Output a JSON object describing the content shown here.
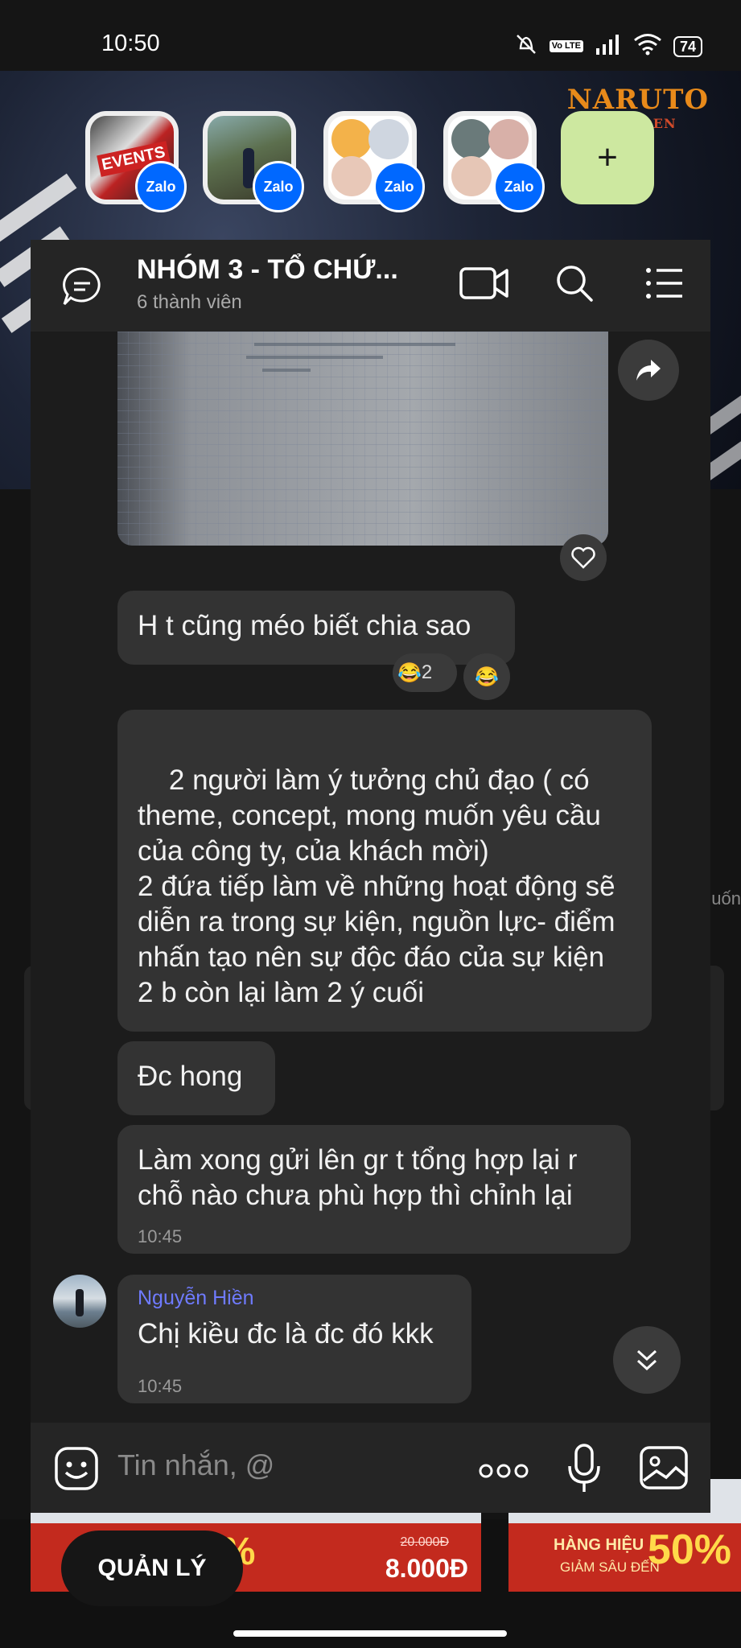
{
  "status_bar": {
    "time": "10:50",
    "network": "Vo LTE",
    "battery": "74"
  },
  "bubble_heads": [
    {
      "name": "events-group",
      "badge": "Zalo"
    },
    {
      "name": "photo-chat",
      "badge": "Zalo"
    },
    {
      "name": "group-chat-1",
      "badge": "Zalo"
    },
    {
      "name": "group-chat-2",
      "badge": "Zalo"
    }
  ],
  "background_app": {
    "banner_title": "NARUTO",
    "banner_sub": "SHIPPUDEN",
    "side_text": "uốn",
    "promo_left": {
      "price": "8.000Đ",
      "old_price": "20.000Đ",
      "percent": "0%"
    },
    "promo_right": {
      "brand": "HÀNG HIỆU",
      "sub": "GIẢM SÂU ĐẾN",
      "percent": "50%"
    },
    "manage_button": "QUẢN LÝ"
  },
  "chat": {
    "title": "NHÓM 3 - TỔ CHỨ...",
    "subtitle": "6 thành viên",
    "messages": [
      {
        "text": "H t cũng méo biết chia sao",
        "reactions": [
          {
            "emoji": "😂",
            "count": "2"
          },
          {
            "emoji": "😂",
            "count": ""
          }
        ]
      },
      {
        "text": "2 người làm ý tưởng chủ đạo ( có theme, concept, mong muốn yêu cầu của công ty, của khách mời)\n2 đứa tiếp làm về những hoạt động sẽ diễn ra trong sự kiện, nguồn lực- điểm nhấn tạo nên sự độc đáo của sự kiện\n2 b còn lại làm 2 ý cuối"
      },
      {
        "text": "Đc hong"
      },
      {
        "text": "Làm xong gửi lên gr t tổng hợp lại r chỗ nào chưa phù hợp thì chỉnh lại",
        "time": "10:45"
      },
      {
        "sender": "Nguyễn Hiền",
        "text": "Chị kiều đc là đc đó kkk",
        "time": "10:45"
      }
    ],
    "composer_placeholder": "Tin nhắn, @"
  }
}
